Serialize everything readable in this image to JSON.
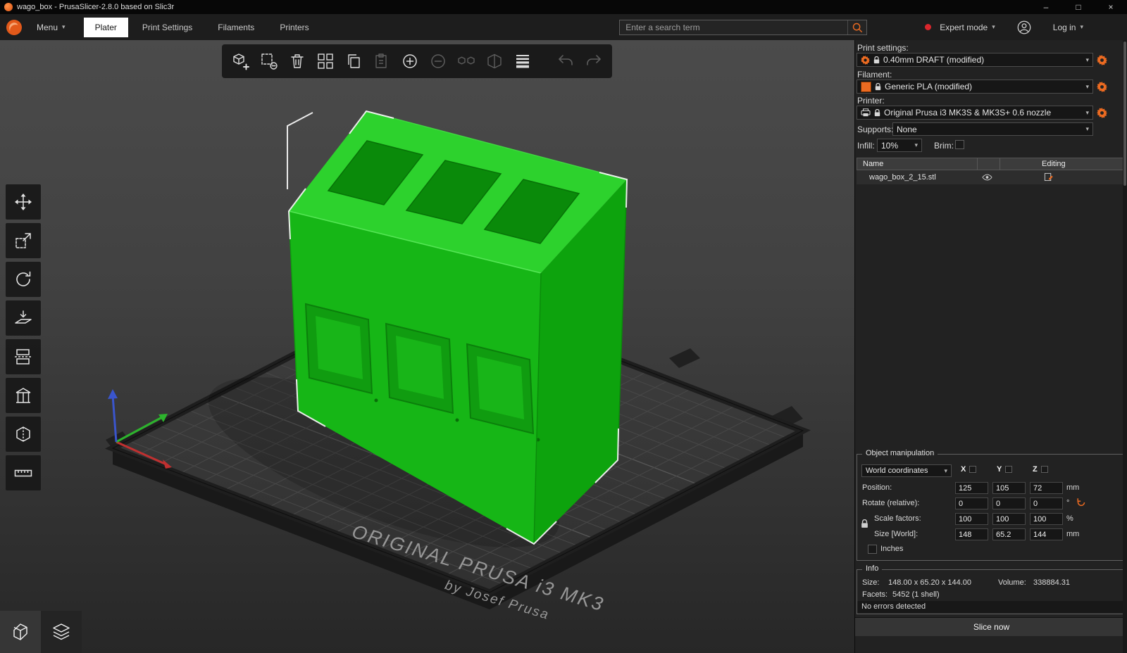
{
  "window": {
    "title": "wago_box - PrusaSlicer-2.8.0 based on Slic3r",
    "minimize": "–",
    "maximize": "□",
    "close": "×"
  },
  "menubar": {
    "menu_label": "Menu",
    "tabs": [
      {
        "label": "Plater"
      },
      {
        "label": "Print Settings"
      },
      {
        "label": "Filaments"
      },
      {
        "label": "Printers"
      }
    ],
    "search_placeholder": "Enter a search term",
    "mode_label": "Expert mode",
    "login_label": "Log in"
  },
  "toolbar_icons": [
    "add",
    "delete",
    "delete-all",
    "arrange",
    "copy",
    "paste",
    "add-instance",
    "remove-instance",
    "split-to-objects",
    "split-to-parts",
    "variable-layer-height",
    "undo",
    "redo"
  ],
  "left_toolbar_icons": [
    "move",
    "scale",
    "rotate",
    "place-on-face",
    "cut",
    "paint-supports",
    "seam-painting",
    "measure"
  ],
  "view_buttons": [
    "3d-editor-view",
    "preview"
  ],
  "viewport": {
    "bed_text_line1": "ORIGINAL PRUSA i3 MK3",
    "bed_text_line2": "by Josef Prusa"
  },
  "panel": {
    "print_settings_label": "Print settings:",
    "print_settings_value": "0.40mm DRAFT (modified)",
    "filament_label": "Filament:",
    "filament_value": "Generic PLA (modified)",
    "filament_color": "#ed6b21",
    "printer_label": "Printer:",
    "printer_value": "Original Prusa i3 MK3S & MK3S+ 0.6 nozzle",
    "supports_label": "Supports:",
    "supports_value": "None",
    "infill_label": "Infill:",
    "infill_value": "10%",
    "brim_label": "Brim:",
    "object_table": {
      "name_header": "Name",
      "editing_header": "Editing",
      "rows": [
        {
          "name": "wago_box_2_15.stl"
        }
      ]
    },
    "manipulation": {
      "title": "Object manipulation",
      "coordinates_value": "World coordinates",
      "axes": [
        "X",
        "Y",
        "Z"
      ],
      "rows": [
        {
          "label": "Position:",
          "x": "125",
          "y": "105",
          "z": "72",
          "unit": "mm"
        },
        {
          "label": "Rotate (relative):",
          "x": "0",
          "y": "0",
          "z": "0",
          "unit": "°"
        },
        {
          "label": "Scale factors:",
          "x": "100",
          "y": "100",
          "z": "100",
          "unit": "%"
        },
        {
          "label": "Size [World]:",
          "x": "148",
          "y": "65.2",
          "z": "144",
          "unit": "mm"
        }
      ],
      "inches_label": "Inches"
    },
    "info": {
      "title": "Info",
      "size_label": "Size:",
      "size_value": "148.00 x 65.20 x 144.00",
      "volume_label": "Volume:",
      "volume_value": "338884.31",
      "facets_label": "Facets:",
      "facets_value": "5452 (1 shell)",
      "errors_text": "No errors detected"
    },
    "slice_button_label": "Slice now"
  },
  "colors": {
    "accent": "#ed6b21",
    "model_green": "#15b815",
    "mode_dot": "#d9262c"
  }
}
